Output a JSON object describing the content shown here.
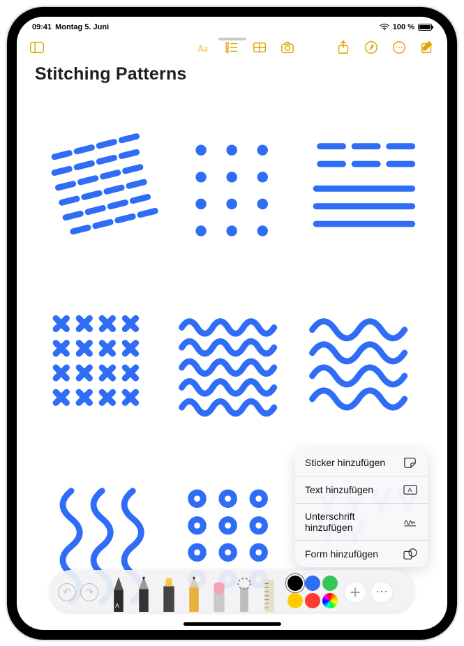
{
  "status": {
    "time": "09:41",
    "date": "Montag 5. Juni",
    "battery": "100 %"
  },
  "note": {
    "title": "Stitching Patterns"
  },
  "popup": {
    "sticker": "Sticker hinzufügen",
    "text": "Text hinzufügen",
    "signature": "Unterschrift hinzufügen",
    "shape": "Form hinzufügen"
  },
  "colors": {
    "black": "#000000",
    "blue": "#2f6df6",
    "green": "#33c658",
    "yellow": "#ffcc00",
    "red": "#ff3b30"
  }
}
